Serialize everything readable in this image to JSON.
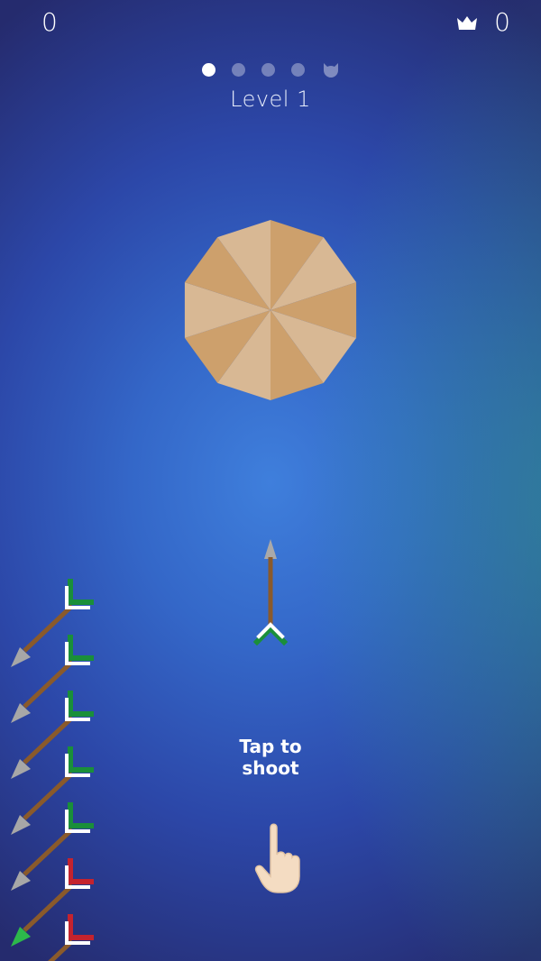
{
  "hud": {
    "score": "0",
    "best_score": "0",
    "crown_icon": "crown-icon"
  },
  "level": {
    "label": "Level 1",
    "stages_total": 5,
    "current_stage": 1,
    "boss_icon": "boss-cat-icon"
  },
  "target": {
    "sides": 10,
    "color_dark": "#cda06c",
    "color_light": "#d8b894"
  },
  "hint": {
    "line1": "Tap to",
    "line2": "shoot",
    "hand_icon": "tap-hand-icon"
  },
  "arrows_remaining": {
    "count": 7,
    "fletching_colors": [
      "green",
      "green",
      "green",
      "green",
      "green",
      "red",
      "red"
    ]
  },
  "colors": {
    "fletch_green": "#1a8f3a",
    "fletch_red": "#c4232e",
    "shaft": "#8a5a2b",
    "tip": "#a7a7a7"
  }
}
